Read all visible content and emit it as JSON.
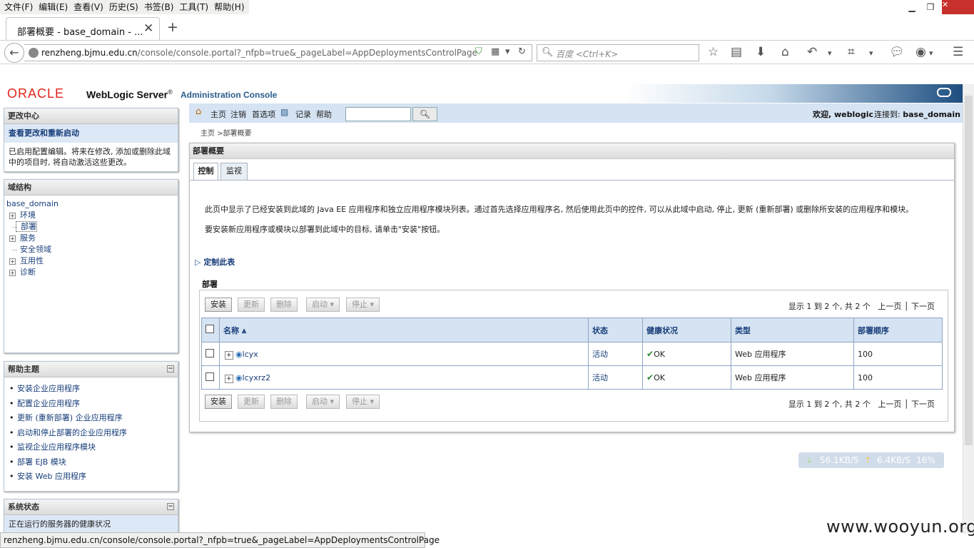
{
  "menu": [
    "文件(F)",
    "编辑(E)",
    "查看(V)",
    "历史(S)",
    "书签(B)",
    "工具(T)",
    "帮助(H)"
  ],
  "tab": {
    "title": "部署概要 - base_domain - ..."
  },
  "url": {
    "host": "renzheng.bjmu.edu.cn",
    "path": "/console/console.portal?_nfpb=true&_pageLabel=AppDeploymentsControlPage"
  },
  "search": {
    "placeholder": "百度 <Ctrl+K>"
  },
  "header": {
    "oracle": "ORACLE",
    "wls": "WebLogic Server",
    "reg": "®",
    "admin": "Administration Console"
  },
  "change_center": {
    "title": "更改中心",
    "link": "查看更改和重新启动",
    "desc": "已启用配置编辑。将来在修改, 添加或删除此域中的项目时, 将自动激活这些更改。"
  },
  "domain_structure": {
    "title": "域结构",
    "root": "base_domain",
    "items": [
      "环境",
      "部署",
      "服务",
      "安全领域",
      "互用性",
      "诊断"
    ]
  },
  "help": {
    "title": "帮助主题",
    "items": [
      "安装企业应用程序",
      "配置企业应用程序",
      "更新 (重新部署) 企业应用程序",
      "启动和停止部署的企业应用程序",
      "监视企业应用程序模块",
      "部署 EJB 模块",
      "安装 Web 应用程序"
    ]
  },
  "system_status": {
    "title": "系统状态",
    "desc": "正在运行的服务器的健康状况"
  },
  "toolbar": {
    "home": "主页",
    "logout": "注销",
    "prefs": "首选项",
    "record": "记录",
    "help": "帮助",
    "welcome": "欢迎, weblogic",
    "connected_label": "连接到:",
    "connected_domain": "base_domain"
  },
  "breadcrumb": "主页 >部署概要",
  "content": {
    "title": "部署概要",
    "tabs": [
      "控制",
      "监视"
    ],
    "intro1": "此页中显示了已经安装到此域的 Java EE 应用程序和独立应用程序模块列表。通过首先选择应用程序名, 然后使用此页中的控件, 可以从此域中启动, 停止, 更新 (重新部署) 或删除所安装的应用程序和模块。",
    "intro2": "要安装新应用程序或模块以部署到此域中的目标, 请单击\"安装\"按钮。",
    "customize": "定制此表",
    "section": "部署"
  },
  "buttons": {
    "install": "安装",
    "update": "更新",
    "delete": "删除",
    "start": "启动",
    "stop": "停止"
  },
  "pager": {
    "info": "显示 1 到 2 个, 共 2 个",
    "prev": "上一页",
    "next": "下一页"
  },
  "table": {
    "headers": [
      "名称",
      "状态",
      "健康状况",
      "类型",
      "部署顺序"
    ],
    "rows": [
      {
        "name": "lcyx",
        "state": "活动",
        "health": "OK",
        "type": "Web 应用程序",
        "order": "100"
      },
      {
        "name": "lcyxrz2",
        "state": "活动",
        "health": "OK",
        "type": "Web 应用程序",
        "order": "100"
      }
    ]
  },
  "netmon": {
    "down": "56.1KB/S",
    "up": "6.4KB/S",
    "pct": "16%"
  },
  "watermark": "www.wooyun.org",
  "statusbar": "renzheng.bjmu.edu.cn/console/console.portal?_nfpb=true&_pageLabel=AppDeploymentsControlPage"
}
